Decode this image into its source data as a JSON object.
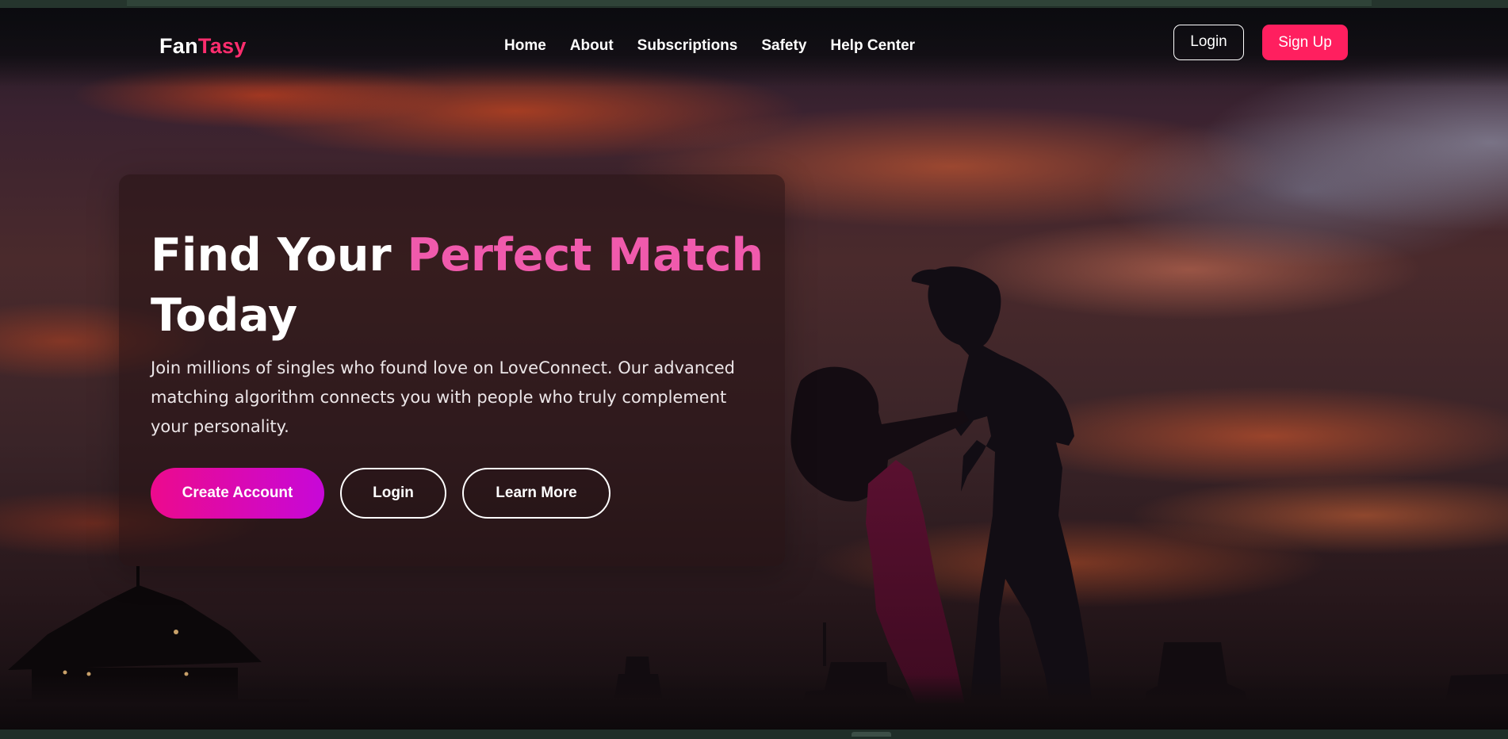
{
  "brand": {
    "logo_part1": "Fan",
    "logo_part2": "Tasy",
    "accent_color": "#ff2d6e"
  },
  "nav": {
    "links": [
      {
        "label": "Home"
      },
      {
        "label": "About"
      },
      {
        "label": "Subscriptions"
      },
      {
        "label": "Safety"
      },
      {
        "label": "Help Center"
      }
    ],
    "login_label": "Login",
    "signup_label": "Sign Up"
  },
  "hero": {
    "headline_part1": "Find Your ",
    "headline_highlight": "Perfect Match",
    "headline_part2": "Today",
    "description": "Join millions of singles who found love on LoveConnect. Our advanced matching algorithm connects you with people who truly complement your personality.",
    "highlight_color": "#f05aac",
    "buttons": {
      "create_account": "Create Account",
      "login": "Login",
      "learn_more": "Learn More"
    }
  }
}
